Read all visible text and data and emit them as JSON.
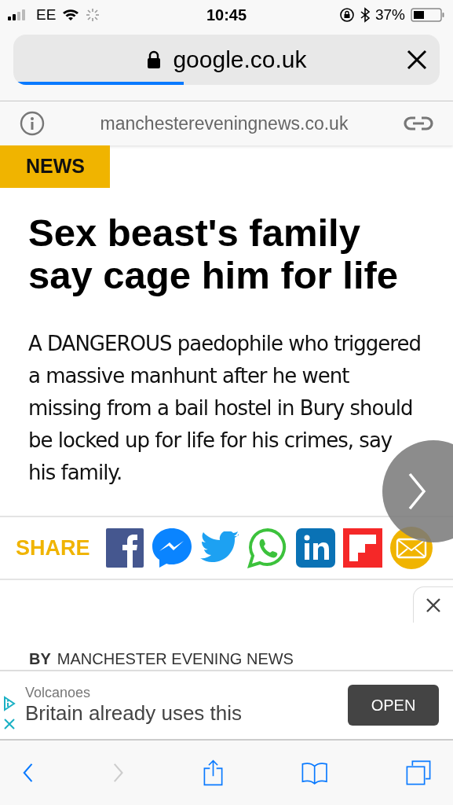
{
  "status_bar": {
    "carrier": "EE",
    "time": "10:45",
    "battery": "37%"
  },
  "address_bar": {
    "url": "google.co.uk",
    "level": 0.4
  },
  "site_bar": {
    "domain": "manchestereveningnews.co.uk"
  },
  "article": {
    "section": "NEWS",
    "headline": "Sex beast's family say cage him for life",
    "summary": "A DANGEROUS paedophile who triggered a massive manhunt after he went missing from a bail hostel in Bury should be locked up for life for his crimes, say his family.",
    "byline_prefix": "BY",
    "byline": "MANCHESTER EVENING NEWS"
  },
  "share": {
    "label": "SHARE",
    "buttons": [
      {
        "kind": "facebook"
      },
      {
        "kind": "messenger"
      },
      {
        "kind": "twitter"
      },
      {
        "kind": "whatsapp"
      },
      {
        "kind": "linkedin"
      },
      {
        "kind": "flipboard"
      },
      {
        "kind": "email"
      }
    ]
  },
  "ad": {
    "advertiser": "Volcanoes",
    "headline": "Britain already uses this",
    "button": "OPEN"
  },
  "toolbar": {
    "buttons": [
      {
        "kind": "back",
        "disabled": false
      },
      {
        "kind": "forward",
        "disabled": true
      },
      {
        "kind": "share"
      },
      {
        "kind": "bookmarks"
      },
      {
        "kind": "tabs"
      }
    ]
  }
}
